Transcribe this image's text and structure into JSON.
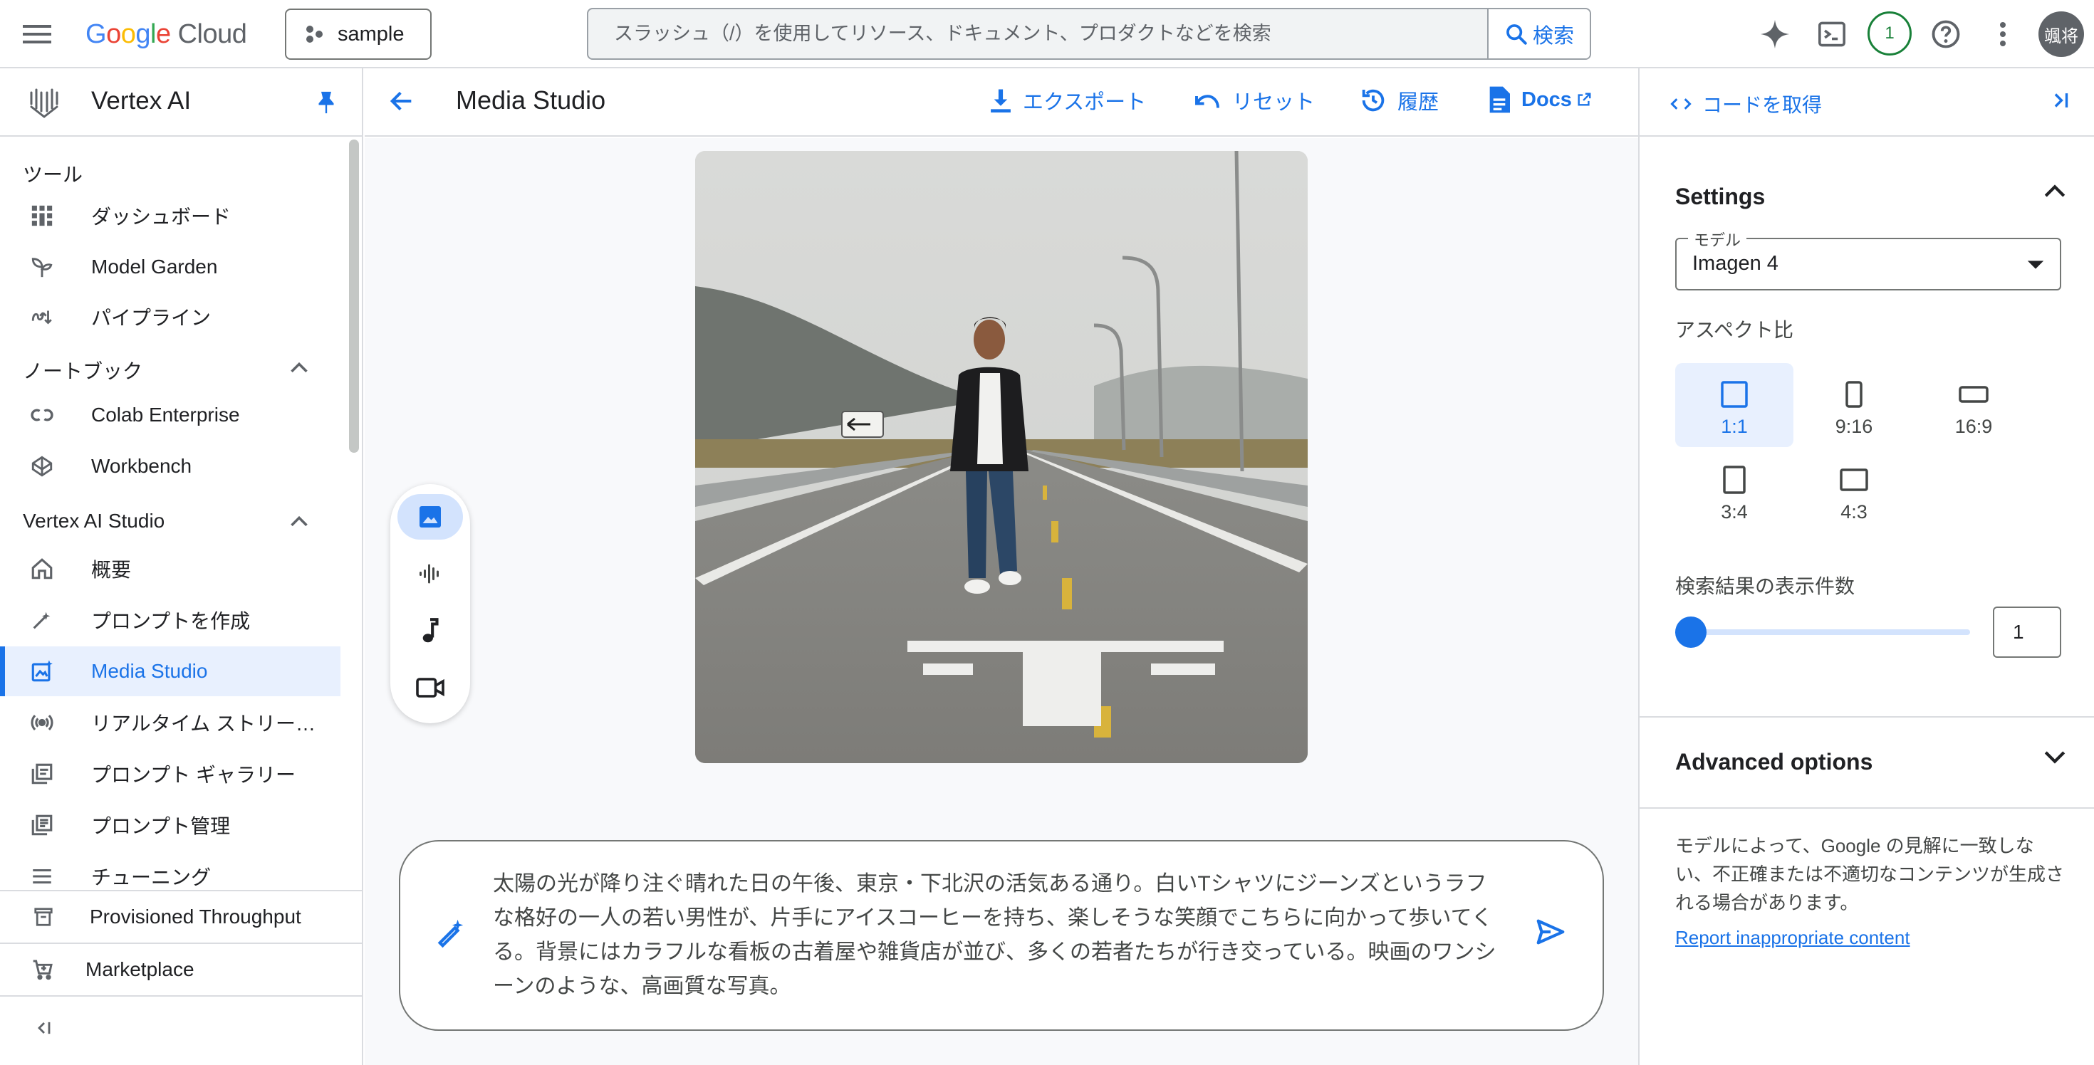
{
  "topbar": {
    "logo_letters": [
      "G",
      "o",
      "o",
      "g",
      "l",
      "e"
    ],
    "logo_suffix": "Cloud",
    "project": "sample",
    "search_placeholder": "スラッシュ（/）を使用してリソース、ドキュメント、プロダクトなどを検索",
    "search_button": "検索",
    "notification_count": "1",
    "avatar_text": "颯将"
  },
  "sidebar": {
    "product": "Vertex AI",
    "sections": {
      "tools": "ツール",
      "notebooks": "ノートブック",
      "studio": "Vertex AI Studio"
    },
    "items": [
      {
        "label": "ダッシュボード",
        "icon": "dashboard-icon"
      },
      {
        "label": "Model Garden",
        "icon": "model-garden-icon"
      },
      {
        "label": "パイプライン",
        "icon": "pipeline-icon"
      },
      {
        "label": "Colab Enterprise",
        "icon": "colab-icon"
      },
      {
        "label": "Workbench",
        "icon": "workbench-icon"
      },
      {
        "label": "概要",
        "icon": "home-icon"
      },
      {
        "label": "プロンプトを作成",
        "icon": "create-prompt-icon"
      },
      {
        "label": "Media Studio",
        "icon": "media-studio-icon",
        "active": true
      },
      {
        "label": "リアルタイム ストリーミング",
        "icon": "stream-icon"
      },
      {
        "label": "プロンプト ギャラリー",
        "icon": "gallery-icon"
      },
      {
        "label": "プロンプト管理",
        "icon": "prompt-manage-icon"
      },
      {
        "label": "チューニング",
        "icon": "tuning-icon"
      }
    ],
    "bottom": {
      "provisioned": "Provisioned Throughput",
      "marketplace": "Marketplace"
    }
  },
  "header": {
    "title": "Media Studio",
    "export": "エクスポート",
    "reset": "リセット",
    "history": "履歴",
    "docs": "Docs"
  },
  "prompt": {
    "text": "太陽の光が降り注ぐ晴れた日の午後、東京・下北沢の活気ある通り。白いTシャツにジーンズというラフな格好の一人の若い男性が、片手にアイスコーヒーを持ち、楽しそうな笑顔でこちらに向かって歩いてくる。背景にはカラフルな看板の古着屋や雑貨店が並び、多くの若者たちが行き交っている。映画のワンシーンのような、高画質な写真。"
  },
  "right_panel": {
    "get_code": "コードを取得",
    "settings_title": "Settings",
    "model_label": "モデル",
    "model_value": "Imagen 4",
    "aspect_title": "アスペクト比",
    "aspect_options": [
      "1:1",
      "9:16",
      "16:9",
      "3:4",
      "4:3"
    ],
    "aspect_selected": "1:1",
    "count_title": "検索結果の表示件数",
    "count_value": "1",
    "count_slider_fraction": 0.0,
    "advanced": "Advanced options",
    "disclaimer": "モデルによって、Google の見解に一致しない、不正確または不適切なコンテンツが生成される場合があります。",
    "report": "Report inappropriate content"
  },
  "colors": {
    "accent": "#1a73e8",
    "active_bg": "#e8f0fe",
    "notif_green": "#188038"
  }
}
